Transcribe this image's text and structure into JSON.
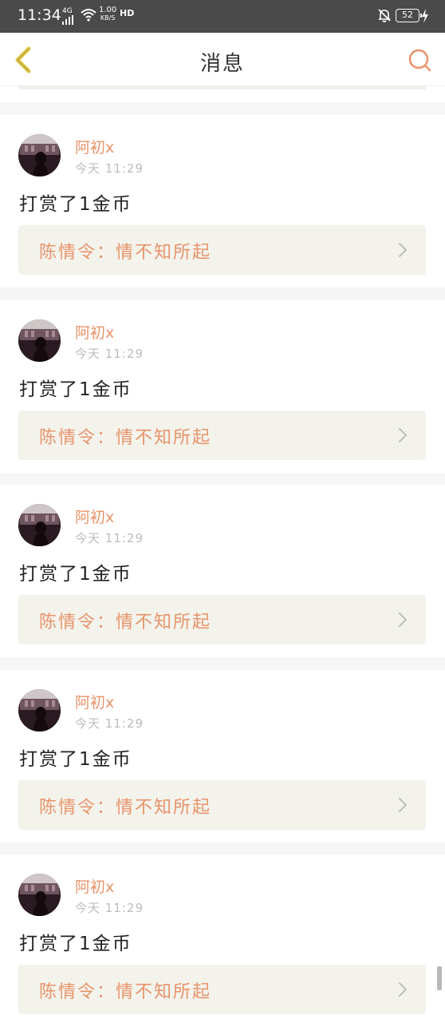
{
  "status_bar": {
    "time": "11:34",
    "network": "4G",
    "speed_value": "1.00",
    "speed_unit": "KB/S",
    "hd": "HD",
    "battery": "52"
  },
  "nav": {
    "title": "消息",
    "back_icon": "chevron-left-icon",
    "search_icon": "search-icon"
  },
  "colors": {
    "accent": "#e8936a",
    "back": "#e0c84a",
    "card_bg": "#f3f3ec"
  },
  "messages": [
    {
      "username": "阿初x",
      "time": "今天 11:29",
      "text": "打赏了1金币",
      "link": "陈情令：情不知所起"
    },
    {
      "username": "阿初x",
      "time": "今天 11:29",
      "text": "打赏了1金币",
      "link": "陈情令：情不知所起"
    },
    {
      "username": "阿初x",
      "time": "今天 11:29",
      "text": "打赏了1金币",
      "link": "陈情令：情不知所起"
    },
    {
      "username": "阿初x",
      "time": "今天 11:29",
      "text": "打赏了1金币",
      "link": "陈情令：情不知所起"
    },
    {
      "username": "阿初x",
      "time": "今天 11:29",
      "text": "打赏了1金币",
      "link": "陈情令：情不知所起"
    }
  ]
}
